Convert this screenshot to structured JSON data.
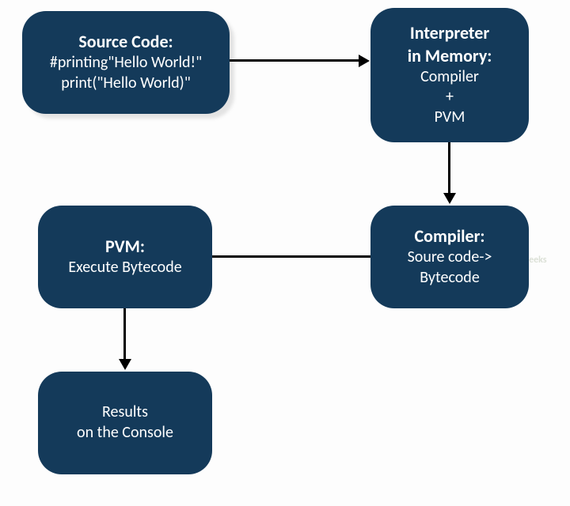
{
  "nodes": {
    "source_code": {
      "title": "Source Code:",
      "line1": "#printing\"Hello World!\"",
      "line2": "print(\"Hello World)\""
    },
    "interpreter": {
      "title1": "Interpreter",
      "title2": "in Memory:",
      "line1": "Compiler",
      "line2": "+",
      "line3": "PVM"
    },
    "compiler": {
      "title": "Compiler:",
      "line1": "Soure code->",
      "line2": "Bytecode"
    },
    "pvm": {
      "title": "PVM:",
      "line1": "Execute Bytecode"
    },
    "results": {
      "line1": "Results",
      "line2": "on the Console"
    }
  },
  "watermark": "Python Geeks",
  "edges": [
    {
      "from": "source_code",
      "to": "interpreter",
      "type": "arrow"
    },
    {
      "from": "interpreter",
      "to": "compiler",
      "type": "arrow"
    },
    {
      "from": "compiler",
      "to": "pvm",
      "type": "line"
    },
    {
      "from": "pvm",
      "to": "results",
      "type": "arrow"
    }
  ]
}
